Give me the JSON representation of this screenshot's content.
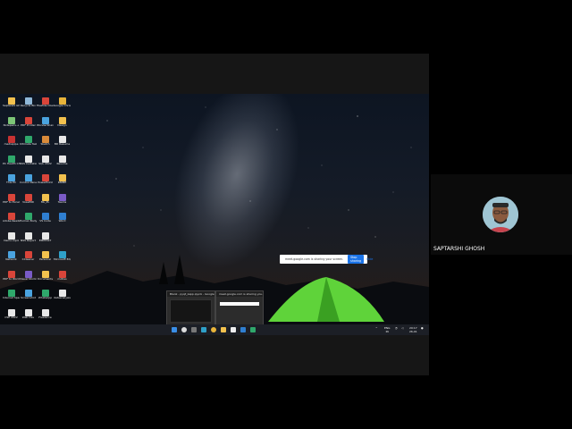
{
  "participant": {
    "name": "SAPTARSHI GHOSH"
  },
  "share_bar": {
    "message": "meet.google.com is sharing your screen.",
    "stop_label": "Stop sharing",
    "hide_label": "Hide"
  },
  "desktop_icons": [
    {
      "label": "Saptarshi Ghosh",
      "color": "#f2c14e",
      "icon": "folder-icon"
    },
    {
      "label": "Notepad++",
      "color": "#7cc576",
      "icon": "notepad-icon"
    },
    {
      "label": "mediapipe",
      "color": "#c83232",
      "icon": "app-icon"
    },
    {
      "label": "PC Health Check",
      "color": "#2fa86b",
      "icon": "health-icon"
    },
    {
      "label": "This PC",
      "color": "#4aa3df",
      "icon": "pc-icon"
    },
    {
      "label": "PDF to Excel",
      "color": "#d9453a",
      "icon": "pdf-icon"
    },
    {
      "label": "Adobe Reader",
      "color": "#d9453a",
      "icon": "pdf-icon"
    },
    {
      "label": "Demo.mp4",
      "color": "#e8e8e8",
      "icon": "file-icon"
    },
    {
      "label": "Network",
      "color": "#4aa3df",
      "icon": "network-icon"
    },
    {
      "label": "PDF to Word",
      "color": "#d9453a",
      "icon": "pdf-icon"
    },
    {
      "label": "Internet Speed",
      "color": "#2fa86b",
      "icon": "app-icon"
    },
    {
      "label": "CSE 2022",
      "color": "#e8e8e8",
      "icon": "file-icon"
    },
    {
      "label": "Recycle Bin",
      "color": "#8fb8d8",
      "icon": "recycle-bin-icon"
    },
    {
      "label": "PDF Printer",
      "color": "#d9453a",
      "icon": "pdf-icon"
    },
    {
      "label": "Ultimate Test",
      "color": "#2fa86b",
      "icon": "app-icon"
    },
    {
      "label": "NSS Invitation",
      "color": "#e8e8e8",
      "icon": "file-icon"
    },
    {
      "label": "Control Panel",
      "color": "#4aa3df",
      "icon": "control-panel-icon"
    },
    {
      "label": "VoxelMD",
      "color": "#d9453a",
      "icon": "app-icon"
    },
    {
      "label": "Human Body",
      "color": "#2fa86b",
      "icon": "app-icon"
    },
    {
      "label": "NSS Report",
      "color": "#e8e8e8",
      "icon": "file-icon"
    },
    {
      "label": "CCleaner",
      "color": "#d9453a",
      "icon": "app-icon"
    },
    {
      "label": "Visual Studio",
      "color": "#7a5bc7",
      "icon": "app-icon"
    },
    {
      "label": "Screenshot",
      "color": "#4aa3df",
      "icon": "app-icon"
    },
    {
      "label": "Web Dev",
      "color": "#e8e8e8",
      "icon": "file-icon"
    },
    {
      "label": "FileZilla Client",
      "color": "#d9453a",
      "icon": "app-icon"
    },
    {
      "label": "WonderShare",
      "color": "#4aa3df",
      "icon": "app-icon"
    },
    {
      "label": "Sketch",
      "color": "#d98b3a",
      "icon": "app-icon"
    },
    {
      "label": "SQL 2022",
      "color": "#e8e8e8",
      "icon": "file-icon"
    },
    {
      "label": "PowerPoint",
      "color": "#d9453a",
      "icon": "app-icon"
    },
    {
      "label": "ML_PL",
      "color": "#f2c14e",
      "icon": "folder-icon"
    },
    {
      "label": "VS Code",
      "color": "#2f7fd1",
      "icon": "app-icon"
    },
    {
      "label": "EMPFAST",
      "color": "#e8e8e8",
      "icon": "file-icon"
    },
    {
      "label": "Personal",
      "color": "#f2c14e",
      "icon": "folder-icon"
    },
    {
      "label": "Documents",
      "color": "#f2c14e",
      "icon": "folder-icon"
    },
    {
      "label": "WhatsApp",
      "color": "#2fa86b",
      "icon": "app-icon"
    },
    {
      "label": "Freelance",
      "color": "#e8e8e8",
      "icon": "file-icon"
    },
    {
      "label": "Google Chrome",
      "color": "#e8b43a",
      "icon": "chrome-icon"
    },
    {
      "label": "Design",
      "color": "#f2c14e",
      "icon": "folder-icon"
    },
    {
      "label": "BD Resume",
      "color": "#e8e8e8",
      "icon": "file-icon"
    },
    {
      "label": "Resume",
      "color": "#e8e8e8",
      "icon": "file-icon"
    },
    {
      "label": "KNIME",
      "color": "#f2c14e",
      "icon": "app-icon"
    },
    {
      "label": "Teams",
      "color": "#7a5bc7",
      "icon": "app-icon"
    },
    {
      "label": "Word",
      "color": "#2f7fd1",
      "icon": "app-icon"
    },
    {
      "label": "",
      "color": "rgba(0,0,0,0)",
      "icon": "empty"
    },
    {
      "label": "Microsoft Edge",
      "color": "#2fa0c8",
      "icon": "edge-icon"
    },
    {
      "label": "mAtlas",
      "color": "#d9453a",
      "icon": "app-icon"
    },
    {
      "label": "dataanalysis",
      "color": "#e8e8e8",
      "icon": "file-icon"
    },
    {
      "label": "",
      "color": "rgba(0,0,0,0)",
      "icon": "empty"
    }
  ],
  "taskbar_previews": [
    {
      "title": "Blank - pyqt_zapp.ipynb - Google C..."
    },
    {
      "title": "meet.google.com is sharing you..."
    }
  ],
  "tray": {
    "lang": "ENG",
    "lang2": "IN",
    "time": "20:17",
    "date": "26-01"
  }
}
